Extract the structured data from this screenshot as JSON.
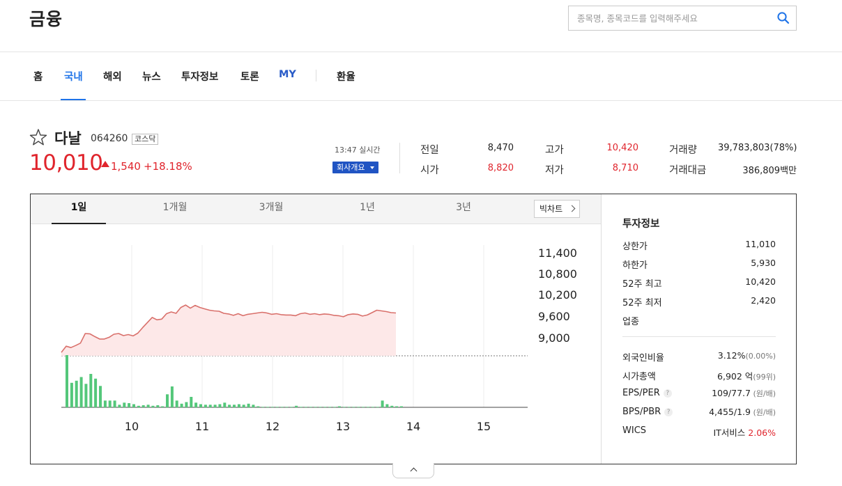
{
  "header": {
    "title": "금융",
    "search_placeholder": "종목명, 종목코드를 입력해주세요"
  },
  "nav": {
    "items": [
      "홈",
      "국내",
      "해외",
      "뉴스",
      "투자정보",
      "토론",
      "MY",
      "환율"
    ],
    "active_index": 1
  },
  "stock": {
    "name": "다날",
    "code": "064260",
    "market": "코스닥",
    "price": "10,010",
    "change": "1,540",
    "change_pct": "+18.18%",
    "time_label": "13:47 실시간",
    "company_button": "회사개요"
  },
  "summary": [
    {
      "label": "전일",
      "value": "8,470",
      "color": "normal"
    },
    {
      "label": "시가",
      "value": "8,820",
      "color": "red"
    },
    {
      "label": "고가",
      "value": "10,420",
      "color": "red"
    },
    {
      "label": "저가",
      "value": "8,710",
      "color": "red"
    },
    {
      "label": "거래량",
      "value": "39,783,803(78%)",
      "color": "normal"
    },
    {
      "label": "거래대금",
      "value": "386,809백만",
      "color": "normal"
    }
  ],
  "chart_tabs": [
    "1일",
    "1개월",
    "3개월",
    "1년",
    "3년"
  ],
  "chart_tab_active": 0,
  "big_chart_label": "빅차트",
  "chart_data": {
    "type": "area",
    "x_ticks": [
      "10",
      "11",
      "12",
      "13",
      "14",
      "15"
    ],
    "y_ticks": [
      "11,400",
      "10,800",
      "10,200",
      "9,600",
      "9,000"
    ],
    "ylim": [
      8470,
      11700
    ],
    "prev_close": 8470,
    "price_series": [
      8570,
      8750,
      8710,
      8770,
      8840,
      9120,
      9110,
      9030,
      8960,
      8960,
      9010,
      9100,
      9120,
      9060,
      9090,
      9050,
      9130,
      9290,
      9440,
      9590,
      9520,
      9540,
      9700,
      9750,
      9710,
      9880,
      9950,
      9860,
      9940,
      9880,
      9840,
      9800,
      9780,
      9770,
      9710,
      9690,
      9650,
      9700,
      9640,
      9680,
      9700,
      9720,
      9740,
      9720,
      9680,
      9700,
      9670,
      9660,
      9660,
      9640,
      9700,
      9720,
      9680,
      9700,
      9670,
      9690,
      9680,
      9650,
      9640,
      9610,
      9670,
      9690,
      9680,
      9630,
      9660,
      9730,
      9800,
      9780,
      9760,
      9730,
      9720
    ],
    "volume_series": [
      100,
      47,
      51,
      58,
      45,
      64,
      55,
      41,
      13,
      13,
      13,
      5,
      9,
      8,
      6,
      3,
      4,
      5,
      3,
      4,
      2,
      25,
      40,
      13,
      7,
      10,
      20,
      9,
      6,
      5,
      5,
      5,
      6,
      9,
      5,
      5,
      6,
      5,
      7,
      5,
      2,
      1,
      1,
      1,
      1,
      1,
      1,
      1,
      3,
      1,
      1,
      1,
      1,
      1,
      1,
      1,
      1,
      2,
      1,
      1,
      1,
      1,
      1,
      1,
      1,
      1,
      13,
      6,
      3,
      2,
      2
    ]
  },
  "invest_info": {
    "title": "투자정보",
    "rows": [
      {
        "label": "상한가",
        "value": "11,010",
        "color": "red"
      },
      {
        "label": "하한가",
        "value": "5,930",
        "color": "blue"
      },
      {
        "label": "52주 최고",
        "value": "10,420",
        "color": "normal"
      },
      {
        "label": "52주 최저",
        "value": "2,420",
        "color": "normal"
      },
      {
        "label": "업종",
        "value": "",
        "color": "normal"
      }
    ],
    "rows2": [
      {
        "label": "외국인비율",
        "value": "3.12%",
        "sub": "(0.00%)",
        "help": false
      },
      {
        "label": "시가총액",
        "value": "6,902 억",
        "sub": "(99위)",
        "help": false
      },
      {
        "label": "EPS/PER",
        "value": "109/77.7",
        "sub": " (원/배)",
        "help": true
      },
      {
        "label": "BPS/PBR",
        "value": "4,455/1.9",
        "sub": " (원/배)",
        "help": true
      },
      {
        "label": "WICS",
        "value": "IT서비스",
        "pct": " 2.06%",
        "help": false
      }
    ]
  }
}
